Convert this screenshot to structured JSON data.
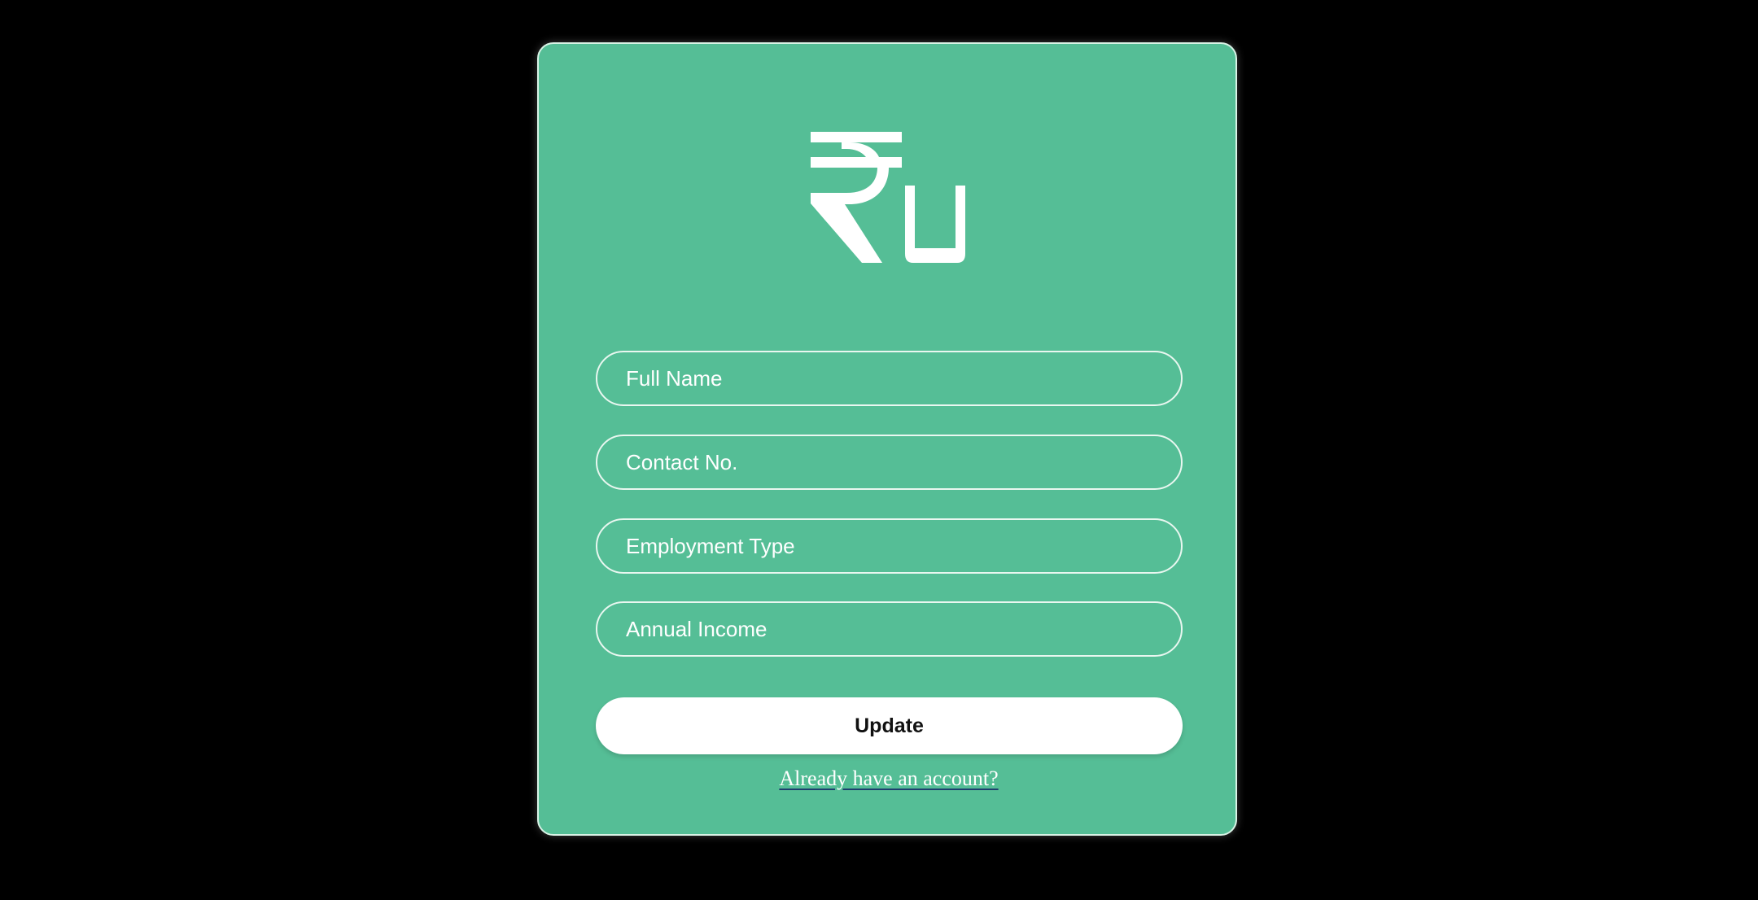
{
  "app": {
    "logo_text": "₹U"
  },
  "form": {
    "full_name_placeholder": "Full Name",
    "contact_placeholder": "Contact No.",
    "employment_placeholder": "Employment Type",
    "income_placeholder": "Annual Income",
    "submit_label": "Update",
    "signin_link": "Already have an account?"
  },
  "colors": {
    "background": "#000000",
    "card": "#55be96",
    "card_border": "#d8f3e6",
    "button": "#ffffff"
  }
}
